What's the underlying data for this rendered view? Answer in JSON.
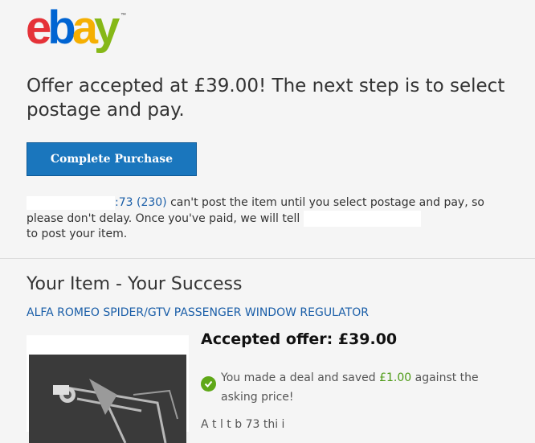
{
  "logo": {
    "letters": [
      "e",
      "b",
      "a",
      "y"
    ],
    "colors": [
      "#e53238",
      "#0064d2",
      "#f5af02",
      "#86b817"
    ],
    "tm": "™"
  },
  "headline": "Offer accepted at £39.00! The next step is to select postage and pay.",
  "button": {
    "label": "Complete Purchase",
    "color": "#1a76bd"
  },
  "note": {
    "seller_partial": ":73",
    "feedback": "(230)",
    "text_1": " can't post the item until you select postage and pay, so please don't delay. Once you've paid, we will tell",
    "text_2": "to post your item."
  },
  "section": {
    "title": "Your Item - Your Success",
    "item_title": "ALFA ROMEO SPIDER/GTV PASSENGER WINDOW REGULATOR"
  },
  "offer": {
    "accepted_label": "Accepted offer: £39.00",
    "deal_prefix": "You made a deal and saved ",
    "saved_amount": "£1.00",
    "deal_suffix": " against the asking price!",
    "cutoff_text": "A                              t            l  t  b  73  thi  i"
  },
  "icons": {
    "deal": "checkmark-icon"
  }
}
